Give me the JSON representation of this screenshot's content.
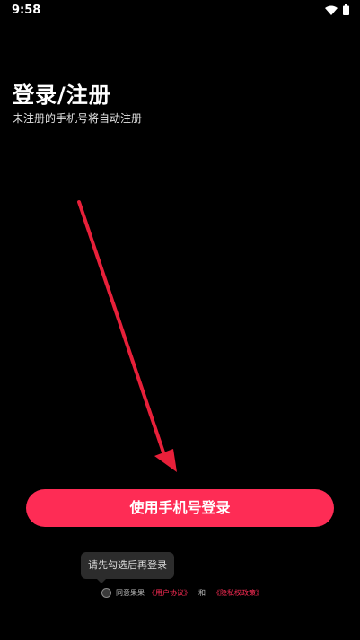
{
  "status_bar": {
    "time": "9:58"
  },
  "header": {
    "title": "登录/注册",
    "subtitle": "未注册的手机号将自动注册"
  },
  "login_button": {
    "label": "使用手机号登录"
  },
  "tooltip": {
    "text": "请先勾选后再登录"
  },
  "agreement": {
    "prefix": "同意果果",
    "user_agreement": "《用户协议》",
    "and": "和",
    "privacy_policy": "《隐私权政策》"
  },
  "colors": {
    "accent": "#fe2c55",
    "background": "#000000",
    "arrow": "#e8203a"
  }
}
